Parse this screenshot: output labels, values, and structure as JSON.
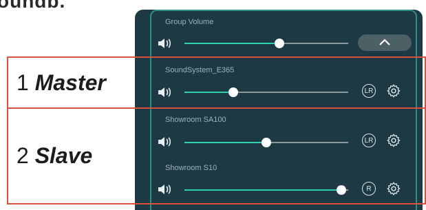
{
  "header": {
    "partial_title": "oundb."
  },
  "group": {
    "label": "Group Volume",
    "volume_fraction": 0.58
  },
  "speakers": [
    {
      "name": "SoundSystem_E365",
      "volume_fraction": 0.3,
      "channel": "LR"
    },
    {
      "name": "Showroom SA100",
      "volume_fraction": 0.5,
      "channel": "LR"
    },
    {
      "name": "Showroom S10",
      "volume_fraction": 0.96,
      "channel": "R"
    }
  ],
  "roles": {
    "master": {
      "number": "1",
      "label": "Master"
    },
    "slave": {
      "number": "2",
      "label": "Slave"
    }
  },
  "colors": {
    "panel": "#1d3a44",
    "accent": "#2fd1b2",
    "border": "#2f8f86",
    "highlight": "#d9503f"
  },
  "icons": {
    "speaker": "speaker-icon",
    "collapse": "chevron-up-icon",
    "settings": "gear-icon"
  }
}
